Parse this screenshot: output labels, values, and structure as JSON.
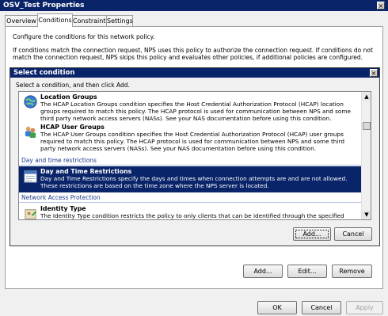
{
  "window": {
    "title": "OSV_Test Properties",
    "close_glyph": "×"
  },
  "tabs": [
    {
      "label": "Overview",
      "active": false
    },
    {
      "label": "Conditions",
      "active": true
    },
    {
      "label": "Constraints",
      "active": false
    },
    {
      "label": "Settings",
      "active": false
    }
  ],
  "conditions_page": {
    "heading": "Configure the conditions for this network policy.",
    "description": "If conditions match the connection request, NPS uses this policy to authorize the connection request. If conditions do not match the connection request, NPS skips this policy and evaluates other policies, if additional policies are configured.",
    "buttons": {
      "add": "Add...",
      "edit": "Edit...",
      "remove": "Remove"
    }
  },
  "select_dialog": {
    "title": "Select condition",
    "close_glyph": "×",
    "instruction": "Select a condition, and then click Add.",
    "items": [
      {
        "title": "Location Groups",
        "description": "The HCAP Location Groups condition specifies the Host Credential Authorization Protocol (HCAP) location groups required to match this policy. The HCAP protocol is used for communication between NPS and some third party network access servers (NASs). See your NAS documentation before using this condition.",
        "icon": "location-groups-icon",
        "selected": false
      },
      {
        "title": "HCAP User Groups",
        "description": "The HCAP User Groups condition specifies the Host Credential Authorization Protocol (HCAP) user groups required to match this policy. The HCAP protocol is used for communication between NPS and some third party network access servers (NASs). See your NAS documentation before using this condition.",
        "icon": "user-groups-icon",
        "selected": false
      },
      {
        "title": "Day and Time Restrictions",
        "description": "Day and Time Restrictions specify the days and times when connection attempts are and are not allowed. These restrictions are based on the time zone where the NPS server is located.",
        "icon": "calendar-icon",
        "selected": true
      },
      {
        "title": "Identity Type",
        "description": "The Identity Type condition restricts the policy to only clients that can be identified through the specified mechanism.",
        "icon": "identity-type-icon",
        "selected": false
      }
    ],
    "groups": [
      "Day and time restrictions",
      "Network Access Protection"
    ],
    "buttons": {
      "add": "Add...",
      "cancel": "Cancel"
    },
    "scroll_position": 0.25
  },
  "footer_buttons": {
    "ok": "OK",
    "cancel": "Cancel",
    "apply": "Apply"
  },
  "colors": {
    "selection": "#0a246a",
    "title_bar": "#0a246a",
    "group_text": "#1f3b8a"
  }
}
